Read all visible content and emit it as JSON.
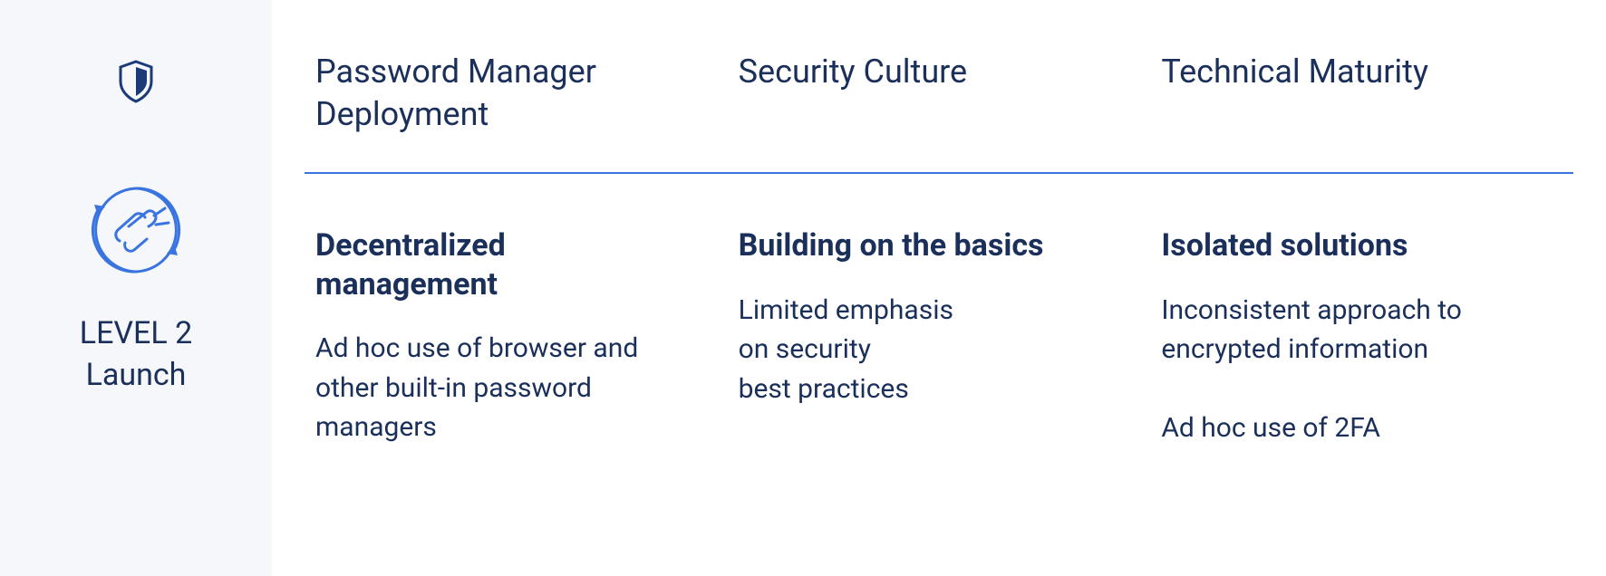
{
  "sidebar": {
    "level_line1": "LEVEL 2",
    "level_line2": "Launch"
  },
  "columns": [
    {
      "header": "Password Manager\nDeployment",
      "title": "Decentralized management",
      "desc": "Ad hoc use of browser and other built-in password managers"
    },
    {
      "header": "Security Culture",
      "title": "Building on the basics",
      "desc": "Limited emphasis\non security\nbest practices"
    },
    {
      "header": "Technical Maturity",
      "title": "Isolated solutions",
      "desc": "Inconsistent approach to encrypted information\n\nAd hoc use of 2FA"
    }
  ]
}
